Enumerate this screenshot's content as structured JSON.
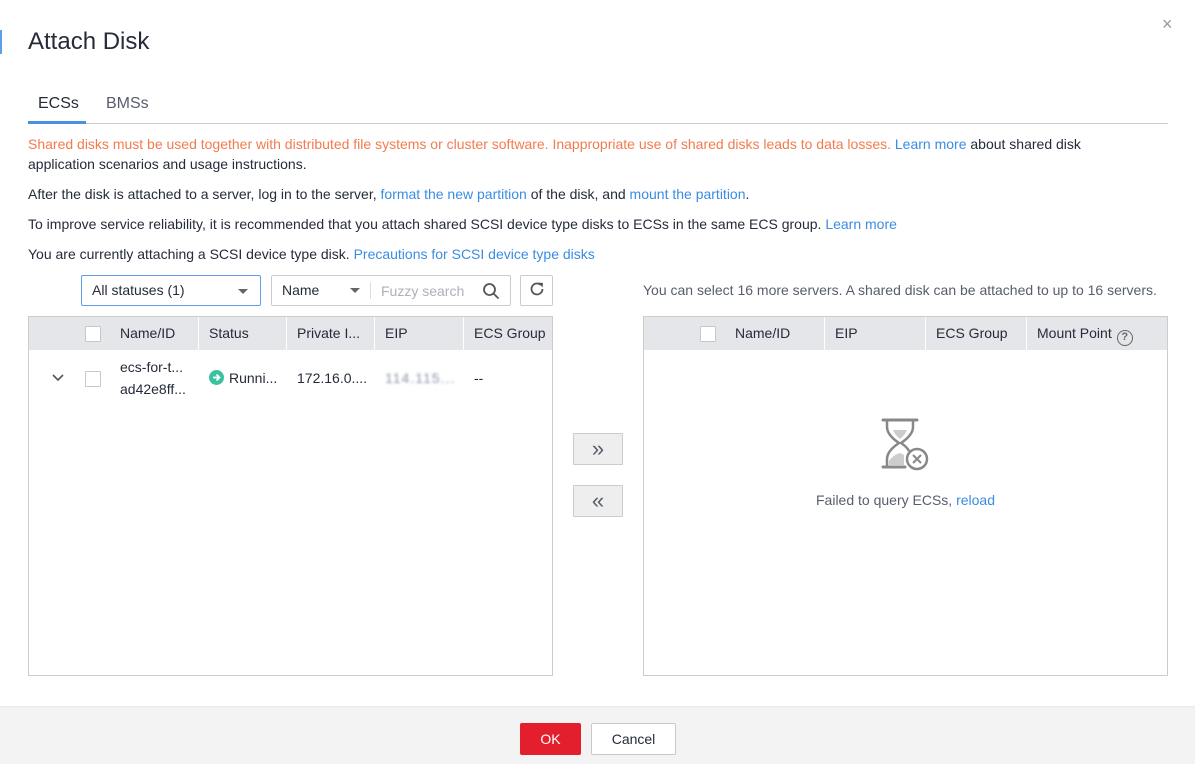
{
  "dialog": {
    "title": "Attach Disk",
    "close_label": "×"
  },
  "tabs": [
    {
      "label": "ECSs",
      "active": true
    },
    {
      "label": "BMSs",
      "active": false
    }
  ],
  "notices": {
    "shared_warning": "Shared disks must be used together with distributed file systems or cluster software. Inappropriate use of shared disks leads to data losses.",
    "shared_learn_more": "Learn more",
    "shared_suffix": " about shared disk application scenarios and usage instructions.",
    "attach_prefix": "After the disk is attached to a server, log in to the server, ",
    "format_link": "format the new partition",
    "attach_middle": " of the disk, and ",
    "mount_link": "mount the partition",
    "attach_suffix": ".",
    "reliability_text": "To improve service reliability, it is recommended that you attach shared SCSI device type disks to ECSs in the same ECS group.",
    "reliability_learn_more": "Learn more",
    "scsi_text": "You are currently attaching a SCSI device type disk.",
    "scsi_link": "Precautions for SCSI device type disks"
  },
  "filters": {
    "status_select": "All statuses (1)",
    "search_field": "Name",
    "search_placeholder": "Fuzzy search",
    "search_value": ""
  },
  "left_table": {
    "columns": [
      "Name/ID",
      "Status",
      "Private I...",
      "EIP",
      "ECS Group"
    ],
    "rows": [
      {
        "name": "ecs-for-t...",
        "id": "ad42e8ff...",
        "status": "Runni...",
        "private_ip": "172.16.0....",
        "eip": "114.115...",
        "ecs_group": "--"
      }
    ]
  },
  "transfer": {
    "add_label": "»",
    "remove_label": "«"
  },
  "right_panel": {
    "note": "You can select 16 more servers. A shared disk can be attached to up to 16 servers.",
    "columns": [
      "Name/ID",
      "EIP",
      "ECS Group",
      "Mount Point"
    ],
    "help_glyph": "?",
    "empty_text": "Failed to query ECSs, ",
    "reload_link": "reload"
  },
  "footer": {
    "ok_label": "OK",
    "cancel_label": "Cancel"
  },
  "colors": {
    "accent": "#3b8ce3",
    "warning": "#f37b4e",
    "primary_button": "#e31e2d",
    "running_status": "#3bc0a0"
  }
}
